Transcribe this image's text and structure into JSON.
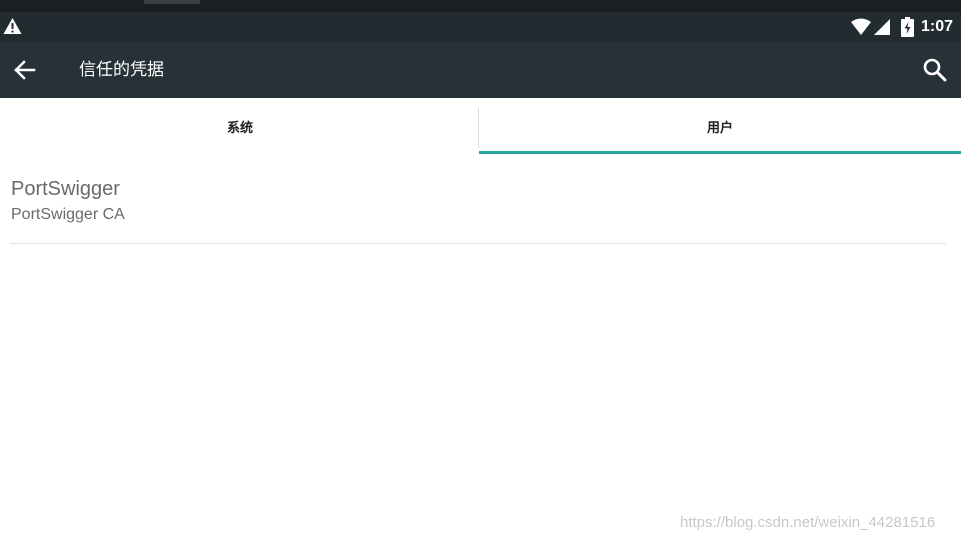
{
  "status_bar": {
    "time": "1:07",
    "icons": [
      "warning-icon",
      "wifi-icon",
      "cell-signal-icon",
      "battery-charging-icon"
    ]
  },
  "app_bar": {
    "title": "信任的凭据",
    "back_icon": "arrow-back-icon",
    "search_icon": "search-icon"
  },
  "tabs": [
    {
      "label": "系统",
      "selected": false
    },
    {
      "label": "用户",
      "selected": true
    }
  ],
  "credentials": [
    {
      "name": "PortSwigger",
      "subtitle": "PortSwigger CA"
    }
  ],
  "watermark": "https://blog.csdn.net/weixin_44281516",
  "colors": {
    "status_bar": "#212b30",
    "app_bar": "#263238",
    "tab_indicator": "#26a69a",
    "list_text": "#6a6a6a"
  }
}
